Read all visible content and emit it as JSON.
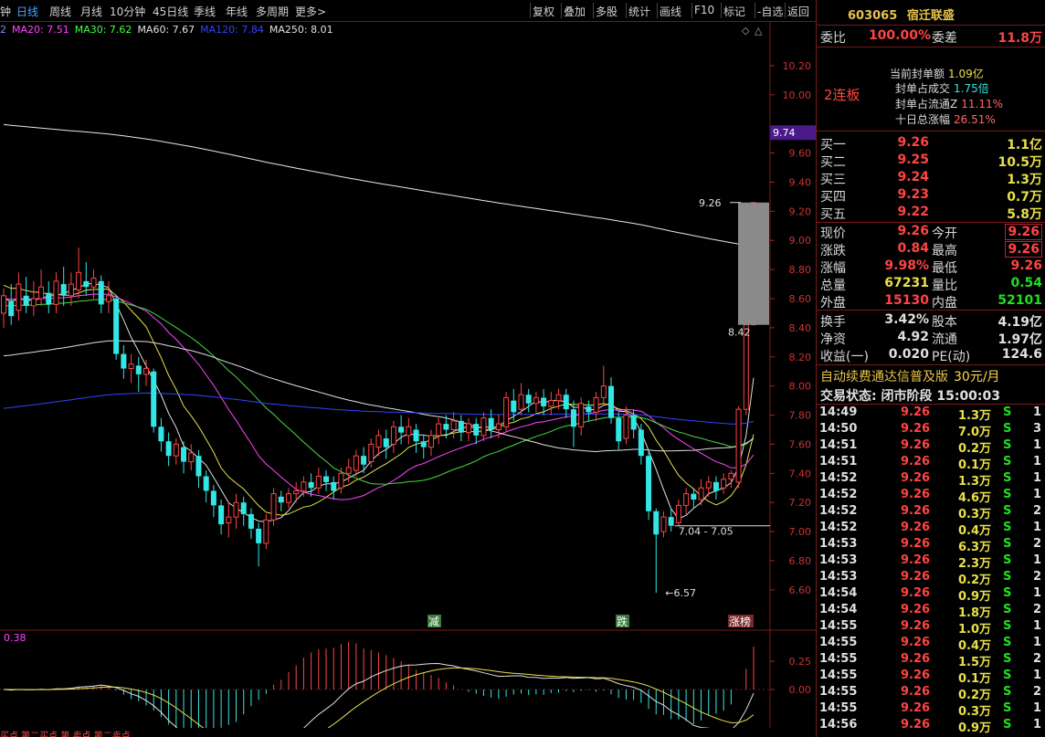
{
  "toolbar": {
    "left_items": [
      "钟",
      "日线",
      "周线",
      "月线",
      "10分钟",
      "45日线",
      "季线",
      "年线",
      "多周期",
      "更多>"
    ],
    "active": "日线",
    "right_items": [
      "复权",
      "叠加",
      "多股",
      "统计",
      "画线",
      "F10",
      "标记",
      "-自选",
      "返回"
    ]
  },
  "ma_legend": [
    {
      "text": "2",
      "color": "#8080ff"
    },
    {
      "text": "MA20: 7.51",
      "color": "#ff44ff"
    },
    {
      "text": "MA30: 7.62",
      "color": "#44ff44"
    },
    {
      "text": "MA60: 7.67",
      "color": "#e0e0e0"
    },
    {
      "text": "MA120: 7.84",
      "color": "#3344ff"
    },
    {
      "text": "MA250: 8.01",
      "color": "#e0e0e0"
    }
  ],
  "chart_data": {
    "type": "candlestick",
    "price_axis": {
      "ticks": [
        "10.20",
        "10.00",
        "9.60",
        "9.40",
        "9.20",
        "9.00",
        "8.80",
        "8.60",
        "8.40",
        "8.20",
        "8.00",
        "7.80",
        "7.60",
        "7.40",
        "7.20",
        "7.00",
        "6.80",
        "6.60"
      ],
      "range": [
        6.48,
        10.4
      ]
    },
    "current_price_label": "9.74",
    "annotations": [
      "9.26",
      "8.42",
      "7.04 - 7.05",
      "6.57"
    ],
    "event_labels": [
      "减",
      "跌",
      "涨榜"
    ],
    "candles": [
      [
        8.5,
        8.62,
        8.4,
        8.67
      ],
      [
        8.58,
        8.48,
        8.42,
        8.7
      ],
      [
        8.52,
        8.7,
        8.45,
        8.78
      ],
      [
        8.62,
        8.55,
        8.5,
        8.75
      ],
      [
        8.55,
        8.6,
        8.48,
        8.72
      ],
      [
        8.6,
        8.68,
        8.55,
        8.8
      ],
      [
        8.64,
        8.56,
        8.5,
        8.72
      ],
      [
        8.56,
        8.72,
        8.5,
        8.78
      ],
      [
        8.7,
        8.62,
        8.55,
        8.82
      ],
      [
        8.62,
        8.7,
        8.55,
        8.78
      ],
      [
        8.66,
        8.78,
        8.6,
        8.95
      ],
      [
        8.72,
        8.68,
        8.62,
        8.85
      ],
      [
        8.68,
        8.74,
        8.6,
        8.8
      ],
      [
        8.72,
        8.56,
        8.5,
        8.76
      ],
      [
        8.58,
        8.62,
        8.5,
        8.72
      ],
      [
        8.6,
        8.22,
        8.18,
        8.62
      ],
      [
        8.22,
        8.12,
        8.05,
        8.28
      ],
      [
        8.12,
        8.15,
        8.02,
        8.22
      ],
      [
        8.14,
        8.08,
        7.96,
        8.2
      ],
      [
        8.08,
        8.12,
        8.0,
        8.18
      ],
      [
        8.1,
        7.72,
        7.68,
        8.12
      ],
      [
        7.72,
        7.62,
        7.55,
        7.78
      ],
      [
        7.62,
        7.52,
        7.45,
        7.68
      ],
      [
        7.52,
        7.6,
        7.46,
        7.64
      ],
      [
        7.58,
        7.48,
        7.4,
        7.62
      ],
      [
        7.48,
        7.54,
        7.42,
        7.6
      ],
      [
        7.52,
        7.38,
        7.3,
        7.56
      ],
      [
        7.38,
        7.28,
        7.2,
        7.42
      ],
      [
        7.28,
        7.18,
        7.1,
        7.32
      ],
      [
        7.18,
        7.05,
        6.98,
        7.22
      ],
      [
        7.06,
        7.1,
        6.96,
        7.2
      ],
      [
        7.1,
        7.2,
        7.02,
        7.26
      ],
      [
        7.2,
        7.12,
        7.04,
        7.24
      ],
      [
        7.12,
        7.02,
        6.95,
        7.16
      ],
      [
        7.02,
        6.92,
        6.76,
        7.06
      ],
      [
        6.92,
        7.08,
        6.88,
        7.12
      ],
      [
        7.08,
        7.26,
        7.04,
        7.3
      ],
      [
        7.24,
        7.2,
        7.14,
        7.28
      ],
      [
        7.2,
        7.26,
        7.16,
        7.3
      ],
      [
        7.26,
        7.28,
        7.2,
        7.34
      ],
      [
        7.28,
        7.34,
        7.24,
        7.38
      ],
      [
        7.34,
        7.3,
        7.24,
        7.4
      ],
      [
        7.3,
        7.38,
        7.26,
        7.44
      ],
      [
        7.38,
        7.34,
        7.28,
        7.42
      ],
      [
        7.34,
        7.28,
        7.22,
        7.38
      ],
      [
        7.3,
        7.4,
        7.26,
        7.44
      ],
      [
        7.4,
        7.44,
        7.34,
        7.5
      ],
      [
        7.42,
        7.52,
        7.38,
        7.56
      ],
      [
        7.52,
        7.46,
        7.4,
        7.58
      ],
      [
        7.48,
        7.6,
        7.44,
        7.64
      ],
      [
        7.58,
        7.66,
        7.52,
        7.7
      ],
      [
        7.64,
        7.58,
        7.5,
        7.7
      ],
      [
        7.6,
        7.72,
        7.54,
        7.76
      ],
      [
        7.72,
        7.68,
        7.6,
        7.8
      ],
      [
        7.66,
        7.72,
        7.6,
        7.78
      ],
      [
        7.7,
        7.62,
        7.54,
        7.74
      ],
      [
        7.62,
        7.58,
        7.5,
        7.66
      ],
      [
        7.58,
        7.66,
        7.52,
        7.7
      ],
      [
        7.66,
        7.74,
        7.6,
        7.78
      ],
      [
        7.74,
        7.7,
        7.64,
        7.8
      ],
      [
        7.7,
        7.76,
        7.64,
        7.82
      ],
      [
        7.76,
        7.68,
        7.62,
        7.8
      ],
      [
        7.68,
        7.74,
        7.62,
        7.78
      ],
      [
        7.74,
        7.66,
        7.6,
        7.78
      ],
      [
        7.66,
        7.78,
        7.62,
        7.82
      ],
      [
        7.78,
        7.7,
        7.64,
        7.84
      ],
      [
        7.7,
        7.74,
        7.64,
        7.8
      ],
      [
        7.72,
        7.92,
        7.68,
        7.96
      ],
      [
        7.9,
        7.82,
        7.76,
        7.98
      ],
      [
        7.84,
        7.94,
        7.8,
        8.02
      ],
      [
        7.94,
        7.88,
        7.82,
        7.98
      ],
      [
        7.88,
        7.92,
        7.82,
        7.96
      ],
      [
        7.92,
        7.86,
        7.8,
        7.98
      ],
      [
        7.86,
        7.9,
        7.8,
        7.96
      ],
      [
        7.9,
        7.94,
        7.84,
        7.98
      ],
      [
        7.94,
        7.84,
        7.78,
        7.98
      ],
      [
        7.84,
        7.72,
        7.58,
        7.9
      ],
      [
        7.72,
        7.88,
        7.66,
        7.92
      ],
      [
        7.86,
        7.82,
        7.76,
        7.9
      ],
      [
        7.82,
        7.92,
        7.76,
        7.96
      ],
      [
        7.92,
        8.0,
        7.86,
        8.14
      ],
      [
        8.0,
        7.78,
        7.74,
        8.06
      ],
      [
        7.78,
        7.62,
        7.56,
        7.82
      ],
      [
        7.64,
        7.8,
        7.6,
        7.86
      ],
      [
        7.8,
        7.7,
        7.64,
        7.84
      ],
      [
        7.7,
        7.52,
        7.46,
        7.74
      ],
      [
        7.52,
        7.14,
        7.08,
        7.56
      ],
      [
        7.14,
        6.98,
        6.58,
        7.16
      ],
      [
        7.0,
        7.1,
        6.96,
        7.14
      ],
      [
        7.1,
        7.04,
        7.0,
        7.16
      ],
      [
        7.06,
        7.18,
        7.04,
        7.22
      ],
      [
        7.18,
        7.26,
        7.12,
        7.3
      ],
      [
        7.26,
        7.22,
        7.16,
        7.3
      ],
      [
        7.22,
        7.3,
        7.18,
        7.36
      ],
      [
        7.3,
        7.34,
        7.24,
        7.38
      ],
      [
        7.34,
        7.28,
        7.22,
        7.38
      ],
      [
        7.3,
        7.36,
        7.26,
        7.4
      ],
      [
        7.36,
        7.4,
        7.3,
        7.42
      ],
      [
        7.34,
        7.84,
        7.3,
        7.86
      ],
      [
        7.84,
        8.42,
        7.8,
        8.42
      ],
      [
        8.42,
        9.26,
        8.42,
        9.26
      ]
    ],
    "indicator": {
      "value_label": "0.38",
      "ticks": [
        "0.25",
        "0.00"
      ]
    }
  },
  "bottom_legend": "买点 第二买点 第 卖点 第二卖点",
  "right_panel": {
    "code": "603065",
    "name": "宿迁联盛",
    "weibi_label": "委比",
    "weibi": "100.00%",
    "weicha_label": "委差",
    "weicha": "11.8万",
    "board": "2连板",
    "seal": [
      {
        "label": "当前封单额",
        "value": "1.09亿"
      },
      {
        "label": "封单占成交",
        "value": "1.75倍"
      },
      {
        "label": "封单占流通Z",
        "value": "11.11%"
      },
      {
        "label": "十日总涨幅",
        "value": "26.51%"
      }
    ],
    "bids": [
      {
        "label": "买一",
        "price": "9.26",
        "vol": "1.1亿"
      },
      {
        "label": "买二",
        "price": "9.25",
        "vol": "10.5万"
      },
      {
        "label": "买三",
        "price": "9.24",
        "vol": "1.3万"
      },
      {
        "label": "买四",
        "price": "9.23",
        "vol": "0.7万"
      },
      {
        "label": "买五",
        "price": "9.22",
        "vol": "5.8万"
      }
    ],
    "quote": [
      {
        "l1": "现价",
        "v1": "9.26",
        "c1": "red",
        "l2": "今开",
        "v2": "9.26",
        "c2": "red",
        "b2": true
      },
      {
        "l1": "涨跌",
        "v1": "0.84",
        "c1": "red",
        "l2": "最高",
        "v2": "9.26",
        "c2": "red",
        "b2": true
      },
      {
        "l1": "涨幅",
        "v1": "9.98%",
        "c1": "red",
        "l2": "最低",
        "v2": "9.26",
        "c2": "red",
        "b2": false
      },
      {
        "l1": "总量",
        "v1": "67231",
        "c1": "yellow",
        "l2": "量比",
        "v2": "0.54",
        "c2": "green",
        "b2": false
      },
      {
        "l1": "外盘",
        "v1": "15130",
        "c1": "red",
        "l2": "内盘",
        "v2": "52101",
        "c2": "green",
        "b2": false
      }
    ],
    "fund": [
      {
        "l1": "换手",
        "v1": "3.42%",
        "l2": "股本",
        "v2": "4.19亿"
      },
      {
        "l1": "净资",
        "v1": "4.92",
        "l2": "流通",
        "v2": "1.97亿"
      },
      {
        "l1": "收益(一)",
        "v1": "0.020",
        "l2": "PE(动)",
        "v2": "124.6"
      }
    ],
    "ad_text": "自动续费通达信普及版",
    "ad_price": "30元/月",
    "status_label": "交易状态:",
    "status_value": "闭市阶段",
    "status_time": "15:00:03",
    "ticks": [
      {
        "t": "14:49",
        "p": "9.26",
        "v": "1.3万",
        "bs": "S",
        "n": "1"
      },
      {
        "t": "14:50",
        "p": "9.26",
        "v": "7.0万",
        "bs": "S",
        "n": "3"
      },
      {
        "t": "14:51",
        "p": "9.26",
        "v": "0.2万",
        "bs": "S",
        "n": "1"
      },
      {
        "t": "14:51",
        "p": "9.26",
        "v": "0.1万",
        "bs": "S",
        "n": "1"
      },
      {
        "t": "14:52",
        "p": "9.26",
        "v": "1.3万",
        "bs": "S",
        "n": "1"
      },
      {
        "t": "14:52",
        "p": "9.26",
        "v": "4.6万",
        "bs": "S",
        "n": "1"
      },
      {
        "t": "14:52",
        "p": "9.26",
        "v": "0.3万",
        "bs": "S",
        "n": "2"
      },
      {
        "t": "14:52",
        "p": "9.26",
        "v": "0.4万",
        "bs": "S",
        "n": "1"
      },
      {
        "t": "14:53",
        "p": "9.26",
        "v": "6.3万",
        "bs": "S",
        "n": "2"
      },
      {
        "t": "14:53",
        "p": "9.26",
        "v": "2.3万",
        "bs": "S",
        "n": "1"
      },
      {
        "t": "14:53",
        "p": "9.26",
        "v": "0.2万",
        "bs": "S",
        "n": "2"
      },
      {
        "t": "14:54",
        "p": "9.26",
        "v": "0.9万",
        "bs": "S",
        "n": "1"
      },
      {
        "t": "14:54",
        "p": "9.26",
        "v": "1.8万",
        "bs": "S",
        "n": "2"
      },
      {
        "t": "14:55",
        "p": "9.26",
        "v": "1.0万",
        "bs": "S",
        "n": "1"
      },
      {
        "t": "14:55",
        "p": "9.26",
        "v": "0.4万",
        "bs": "S",
        "n": "1"
      },
      {
        "t": "14:55",
        "p": "9.26",
        "v": "1.5万",
        "bs": "S",
        "n": "2"
      },
      {
        "t": "14:55",
        "p": "9.26",
        "v": "0.1万",
        "bs": "S",
        "n": "1"
      },
      {
        "t": "14:55",
        "p": "9.26",
        "v": "0.2万",
        "bs": "S",
        "n": "2"
      },
      {
        "t": "14:55",
        "p": "9.26",
        "v": "0.3万",
        "bs": "S",
        "n": "1"
      },
      {
        "t": "14:56",
        "p": "9.26",
        "v": "0.9万",
        "bs": "S",
        "n": "1"
      }
    ]
  }
}
